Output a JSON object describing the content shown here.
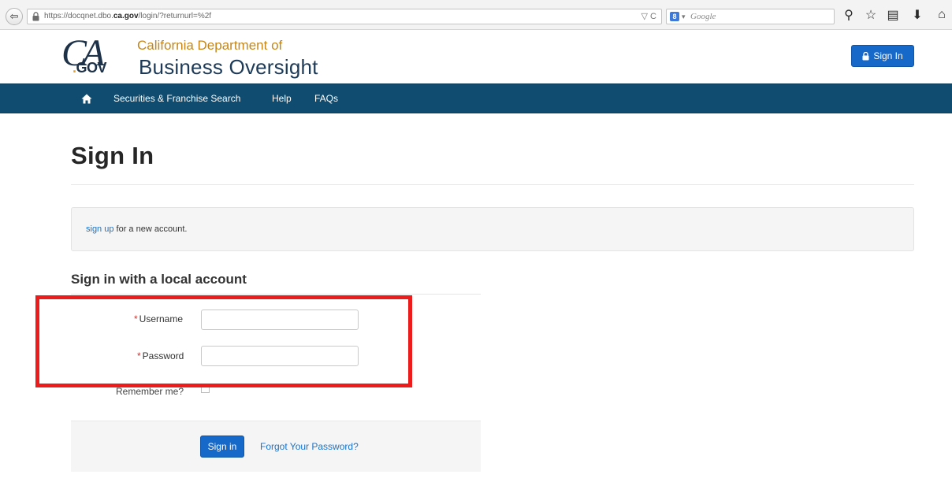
{
  "browser": {
    "url_prefix": "https://docqnet.dbo.",
    "url_domain": "ca.gov",
    "url_suffix": "/login/?returnurl=%2f",
    "url_right": "▽ C",
    "search_engine_badge": "8",
    "search_caret": "▾",
    "search_placeholder": "Google",
    "back_glyph": "⇦",
    "icons": {
      "search": "⚲",
      "bookmark_star": "☆",
      "bookmarks_list": "▤",
      "downloads": "⬇",
      "home": "⌂"
    }
  },
  "header": {
    "logo_ca": "CA",
    "logo_gov_dot": ".",
    "logo_gov": "GOV",
    "dept_line1": "California Department of",
    "dept_line2": "Business Oversight",
    "signin_label": "Sign In"
  },
  "nav": {
    "items": [
      {
        "label": "Securities & Franchise Search"
      },
      {
        "label": "Help"
      },
      {
        "label": "FAQs"
      }
    ]
  },
  "main": {
    "title": "Sign In",
    "info_link": "sign up",
    "info_text": " for a new account.",
    "section_heading": "Sign in with a local account",
    "required_mark": "*",
    "username_label": "Username",
    "username_value": "",
    "password_label": "Password",
    "password_value": "",
    "remember_label": "Remember me?",
    "submit_label": "Sign in",
    "forgot_label": "Forgot Your Password?"
  },
  "colors": {
    "nav_bg": "#0f4c6f",
    "primary_button": "#1669c8",
    "highlight_border": "#ec1c1c",
    "link": "#1a73c9",
    "dept_line1": "#c68617",
    "dept_line2": "#1d3b58"
  }
}
